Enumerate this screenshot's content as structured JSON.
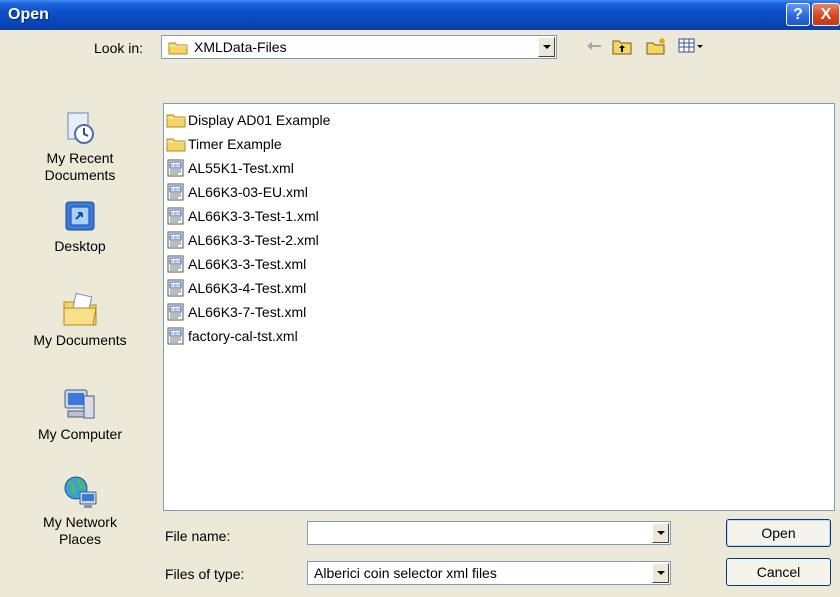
{
  "window": {
    "title": "Open"
  },
  "look_in": {
    "label": "Look in:",
    "value": "XMLData-Files"
  },
  "places": [
    {
      "label": "My Recent\nDocuments"
    },
    {
      "label": "Desktop"
    },
    {
      "label": "My Documents"
    },
    {
      "label": "My Computer"
    },
    {
      "label": "My Network\nPlaces"
    }
  ],
  "files": [
    {
      "name": "Display AD01 Example",
      "type": "folder"
    },
    {
      "name": "Timer Example",
      "type": "folder"
    },
    {
      "name": "AL55K1-Test.xml",
      "type": "xml"
    },
    {
      "name": "AL66K3-03-EU.xml",
      "type": "xml"
    },
    {
      "name": "AL66K3-3-Test-1.xml",
      "type": "xml"
    },
    {
      "name": "AL66K3-3-Test-2.xml",
      "type": "xml"
    },
    {
      "name": "AL66K3-3-Test.xml",
      "type": "xml"
    },
    {
      "name": "AL66K3-4-Test.xml",
      "type": "xml"
    },
    {
      "name": "AL66K3-7-Test.xml",
      "type": "xml"
    },
    {
      "name": "factory-cal-tst.xml",
      "type": "xml"
    }
  ],
  "file_name": {
    "label": "File name:",
    "value": ""
  },
  "file_type": {
    "label": "Files of type:",
    "value": "Alberici coin selector xml files"
  },
  "buttons": {
    "open": "Open",
    "cancel": "Cancel",
    "help": "?",
    "close": "X"
  },
  "colors": {
    "titlebar": "#0846b8",
    "dialog_bg": "#ece9d8",
    "folder": "#f4d565"
  }
}
